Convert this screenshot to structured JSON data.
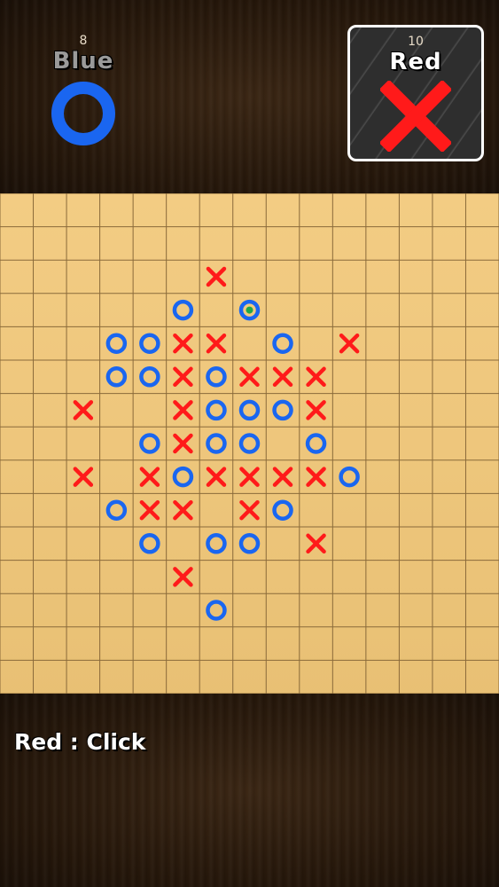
{
  "players": {
    "blue": {
      "name": "Blue",
      "score": "8",
      "symbol": "O",
      "color": "#1a66f0"
    },
    "red": {
      "name": "Red",
      "score": "10",
      "symbol": "X",
      "color": "#ff1a1a",
      "active": true
    }
  },
  "board": {
    "cols": 15,
    "rows": 15,
    "last_move_color": "#1fa84a",
    "marks": [
      {
        "col": 6,
        "row": 2,
        "type": "X"
      },
      {
        "col": 5,
        "row": 3,
        "type": "O"
      },
      {
        "col": 7,
        "row": 3,
        "type": "O",
        "last": true
      },
      {
        "col": 3,
        "row": 4,
        "type": "O"
      },
      {
        "col": 4,
        "row": 4,
        "type": "O"
      },
      {
        "col": 5,
        "row": 4,
        "type": "X"
      },
      {
        "col": 6,
        "row": 4,
        "type": "X"
      },
      {
        "col": 8,
        "row": 4,
        "type": "O"
      },
      {
        "col": 10,
        "row": 4,
        "type": "X"
      },
      {
        "col": 3,
        "row": 5,
        "type": "O"
      },
      {
        "col": 4,
        "row": 5,
        "type": "O"
      },
      {
        "col": 5,
        "row": 5,
        "type": "X"
      },
      {
        "col": 6,
        "row": 5,
        "type": "O"
      },
      {
        "col": 7,
        "row": 5,
        "type": "X"
      },
      {
        "col": 8,
        "row": 5,
        "type": "X"
      },
      {
        "col": 9,
        "row": 5,
        "type": "X"
      },
      {
        "col": 2,
        "row": 6,
        "type": "X"
      },
      {
        "col": 5,
        "row": 6,
        "type": "X"
      },
      {
        "col": 6,
        "row": 6,
        "type": "O"
      },
      {
        "col": 7,
        "row": 6,
        "type": "O"
      },
      {
        "col": 8,
        "row": 6,
        "type": "O"
      },
      {
        "col": 9,
        "row": 6,
        "type": "X"
      },
      {
        "col": 4,
        "row": 7,
        "type": "O"
      },
      {
        "col": 5,
        "row": 7,
        "type": "X"
      },
      {
        "col": 6,
        "row": 7,
        "type": "O"
      },
      {
        "col": 7,
        "row": 7,
        "type": "O"
      },
      {
        "col": 9,
        "row": 7,
        "type": "O"
      },
      {
        "col": 2,
        "row": 8,
        "type": "X"
      },
      {
        "col": 4,
        "row": 8,
        "type": "X"
      },
      {
        "col": 5,
        "row": 8,
        "type": "O"
      },
      {
        "col": 6,
        "row": 8,
        "type": "X"
      },
      {
        "col": 7,
        "row": 8,
        "type": "X"
      },
      {
        "col": 8,
        "row": 8,
        "type": "X"
      },
      {
        "col": 9,
        "row": 8,
        "type": "X"
      },
      {
        "col": 10,
        "row": 8,
        "type": "O"
      },
      {
        "col": 3,
        "row": 9,
        "type": "O"
      },
      {
        "col": 4,
        "row": 9,
        "type": "X"
      },
      {
        "col": 5,
        "row": 9,
        "type": "X"
      },
      {
        "col": 7,
        "row": 9,
        "type": "X"
      },
      {
        "col": 8,
        "row": 9,
        "type": "O"
      },
      {
        "col": 4,
        "row": 10,
        "type": "O"
      },
      {
        "col": 6,
        "row": 10,
        "type": "O"
      },
      {
        "col": 7,
        "row": 10,
        "type": "O"
      },
      {
        "col": 9,
        "row": 10,
        "type": "X"
      },
      {
        "col": 5,
        "row": 11,
        "type": "X"
      },
      {
        "col": 6,
        "row": 12,
        "type": "O"
      }
    ]
  },
  "status": {
    "text": "Red : Click"
  }
}
